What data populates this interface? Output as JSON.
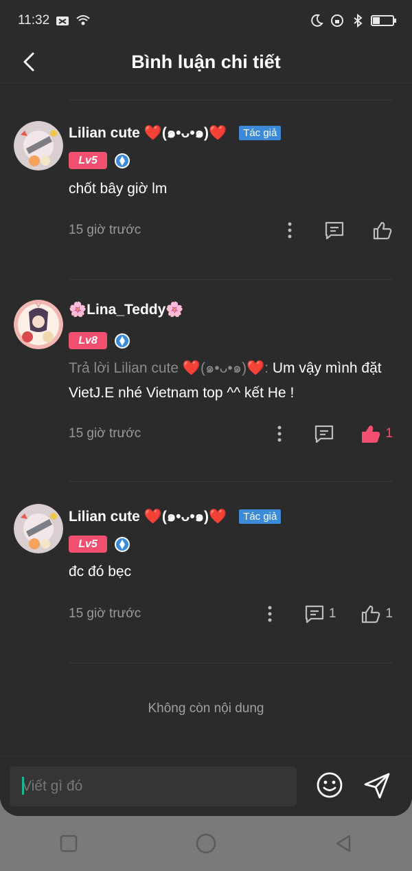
{
  "status_bar": {
    "time": "11:32"
  },
  "header": {
    "title": "Bình luận chi tiết"
  },
  "comments": [
    {
      "user": "Lilian cute ❤️(๑•ᴗ•๑)❤️",
      "author_tag": "Tác giả",
      "level": "Lv5",
      "text": "chốt bây giờ lm",
      "time": "15 giờ trước",
      "reply_count": "",
      "like_count": ""
    },
    {
      "user": "🌸Lina_Teddy🌸",
      "level": "Lv8",
      "reply_prefix": "Trả lời Lilian cute ❤️(๑•ᴗ•๑)❤️:",
      "text": " Um vậy mình đặt VietJ.E nhé Vietnam top ^^ kết He !",
      "time": "15 giờ trước",
      "like_count": "1"
    },
    {
      "user": "Lilian cute ❤️(๑•ᴗ•๑)❤️",
      "author_tag": "Tác giả",
      "level": "Lv5",
      "text": "đc đó bẹc",
      "time": "15 giờ trước",
      "reply_count": "1",
      "like_count": "1"
    }
  ],
  "end_message": "Không còn nội dung",
  "composer": {
    "placeholder": "Viết gì đó"
  },
  "colors": {
    "background": "#2b2b2b",
    "level_badge": "#f24f71",
    "author_tag": "#3d8bd8",
    "liked": "#f24f71",
    "caret": "#17b890"
  },
  "icons": [
    "back-icon",
    "more-icon",
    "reply-icon",
    "like-icon",
    "emoji-icon",
    "send-icon"
  ]
}
